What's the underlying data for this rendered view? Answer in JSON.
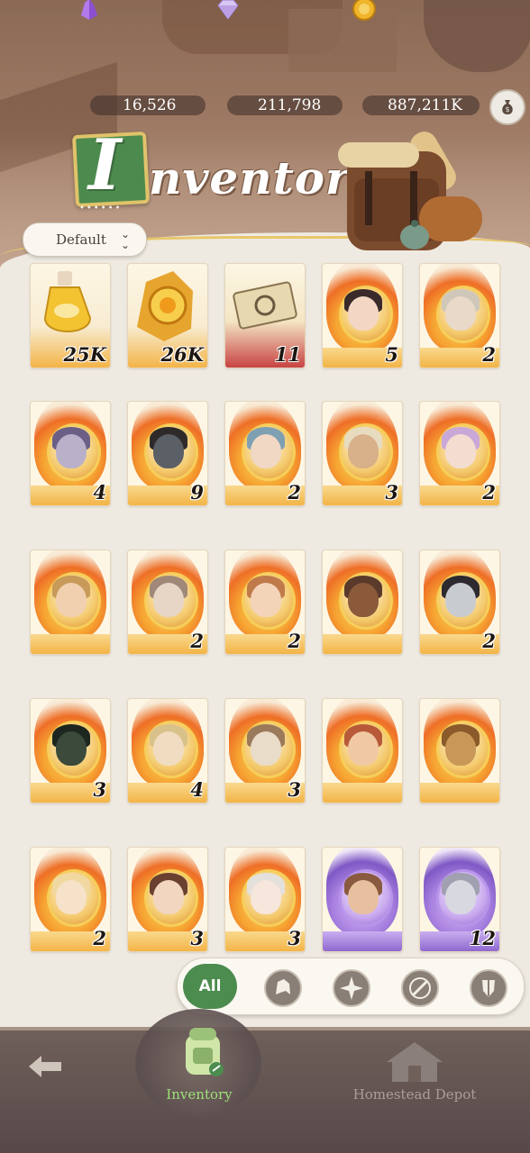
{
  "currencies": [
    {
      "icon": "purple-crystal-icon",
      "amount": "16,526"
    },
    {
      "icon": "diamond-icon",
      "amount": "211,798"
    },
    {
      "icon": "gold-coin-icon",
      "amount": "887,211K"
    }
  ],
  "header": {
    "title_initial": "I",
    "title_rest": "nventory",
    "dots": "••••••"
  },
  "sort": {
    "label": "Default"
  },
  "items": [
    {
      "type": "item",
      "name": "potion-bottle-icon",
      "qty": "25K"
    },
    {
      "type": "item",
      "name": "amber-crystal-icon",
      "qty": "26K"
    },
    {
      "type": "item",
      "name": "ticket-icon",
      "qty": "11"
    },
    {
      "type": "fire",
      "name": "hero-card",
      "qty": "5",
      "skin": "#f3d7c4",
      "hair": "#3a2a2a"
    },
    {
      "type": "fire",
      "name": "hero-card",
      "qty": "2",
      "skin": "#e9d9c8",
      "hair": "#cfc7b9"
    },
    {
      "type": "fire",
      "name": "hero-card",
      "qty": "4",
      "skin": "#b9b1c9",
      "hair": "#6b5f86"
    },
    {
      "type": "fire",
      "name": "hero-card",
      "qty": "9",
      "skin": "#5b5f66",
      "hair": "#2f2a2a"
    },
    {
      "type": "fire",
      "name": "hero-card",
      "qty": "2",
      "skin": "#f0d8c4",
      "hair": "#7f9fb2"
    },
    {
      "type": "fire",
      "name": "hero-card",
      "qty": "3",
      "skin": "#d8b08a",
      "hair": "#e7dcc0"
    },
    {
      "type": "fire",
      "name": "hero-card",
      "qty": "2",
      "skin": "#f3ddd0",
      "hair": "#c9a8d8"
    },
    {
      "type": "fire",
      "name": "hero-card",
      "qty": "",
      "skin": "#f0d0ae",
      "hair": "#c79a5a"
    },
    {
      "type": "fire",
      "name": "hero-card",
      "qty": "2",
      "skin": "#e7d6c6",
      "hair": "#a08878"
    },
    {
      "type": "fire",
      "name": "hero-card",
      "qty": "2",
      "skin": "#f3d4b9",
      "hair": "#c07a4a"
    },
    {
      "type": "fire",
      "name": "hero-card",
      "qty": "",
      "skin": "#8a5a3a",
      "hair": "#5a3a2a"
    },
    {
      "type": "fire",
      "name": "hero-card",
      "qty": "2",
      "skin": "#c8ccd1",
      "hair": "#2d2a30"
    },
    {
      "type": "fire",
      "name": "hero-card",
      "qty": "3",
      "skin": "#3b4a3b",
      "hair": "#1e2620"
    },
    {
      "type": "fire",
      "name": "hero-card",
      "qty": "4",
      "skin": "#f0dcc0",
      "hair": "#d9c18a"
    },
    {
      "type": "fire",
      "name": "hero-card",
      "qty": "3",
      "skin": "#e9dcc8",
      "hair": "#9a7a5a"
    },
    {
      "type": "fire",
      "name": "hero-card",
      "qty": "",
      "skin": "#f0c8a4",
      "hair": "#b85a3a"
    },
    {
      "type": "fire",
      "name": "hero-card",
      "qty": "",
      "skin": "#c99858",
      "hair": "#8a5a2a"
    },
    {
      "type": "fire",
      "name": "hero-card",
      "qty": "2",
      "skin": "#f6e2c8",
      "hair": "#f0d8a0"
    },
    {
      "type": "fire",
      "name": "hero-card",
      "qty": "3",
      "skin": "#f2d6c0",
      "hair": "#6a4030"
    },
    {
      "type": "fire",
      "name": "hero-card",
      "qty": "3",
      "skin": "#f6e6dc",
      "hair": "#e4e0dc"
    },
    {
      "type": "purple",
      "name": "hero-card",
      "qty": "",
      "skin": "#e8c0a0",
      "hair": "#8a5a40"
    },
    {
      "type": "purple",
      "name": "hero-card",
      "qty": "12",
      "skin": "#d8d8e0",
      "hair": "#a0a0b0"
    }
  ],
  "filters": {
    "all_label": "All",
    "icons": [
      "warrior-helmet-icon",
      "compass-star-icon",
      "crossed-blades-icon",
      "shield-sword-icon"
    ]
  },
  "nav": {
    "inventory_label": "Inventory",
    "depot_label": "Homestead Depot"
  }
}
